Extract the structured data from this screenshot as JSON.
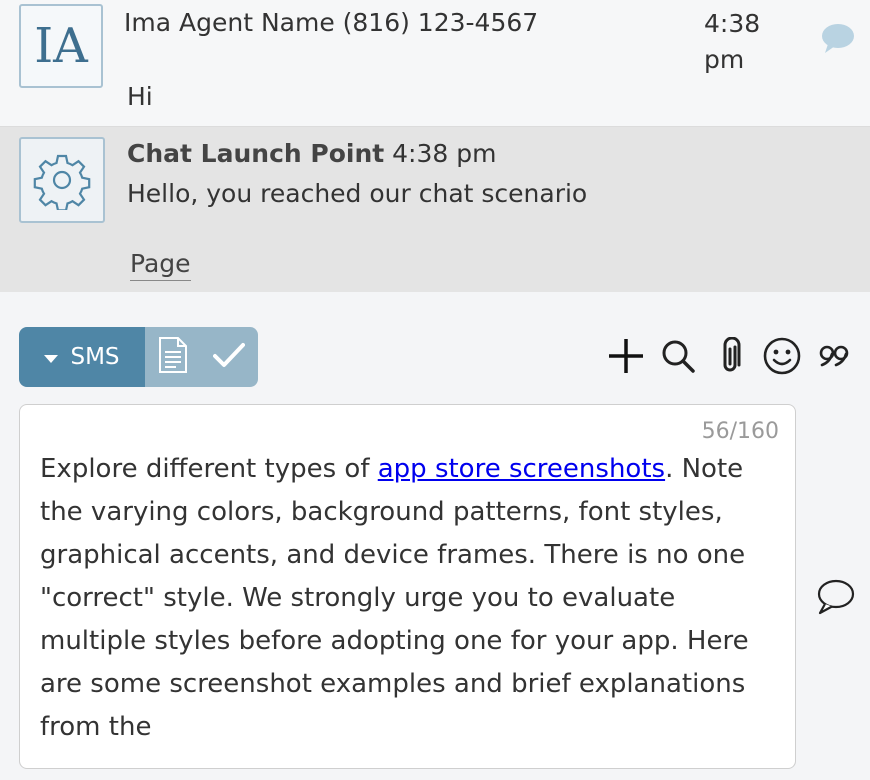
{
  "messages": [
    {
      "avatar_initials": "IA",
      "sender": "Ima Agent Name (816) 123-4567",
      "time": "4:38 pm",
      "text": "Hi"
    },
    {
      "sender": "Chat Launch Point",
      "time": "4:38 pm",
      "text": "Hello, you reached our chat scenario",
      "link": "Page"
    }
  ],
  "toolbar": {
    "channel_label": "SMS",
    "icons": [
      "caret-down-icon",
      "document-icon",
      "checkmark-icon",
      "plus-icon",
      "search-icon",
      "paperclip-icon",
      "smiley-icon",
      "quote-icon"
    ]
  },
  "composer": {
    "counter": "56/160",
    "text_before_link": "Explore different types of ",
    "link_text": "app store screenshots",
    "text_after_link": ". Note the varying colors, background patterns, font styles, graphical accents, and device frames. There is no one \"correct\" style. We strongly urge you to evaluate multiple styles before adopting one for your app. Here are some screenshot examples and brief explanations from the"
  },
  "colors": {
    "accent": "#4f86a6",
    "accent_light": "#97b6c8",
    "system_message_bg": "#e4e4e4",
    "link": "#0000ee"
  }
}
